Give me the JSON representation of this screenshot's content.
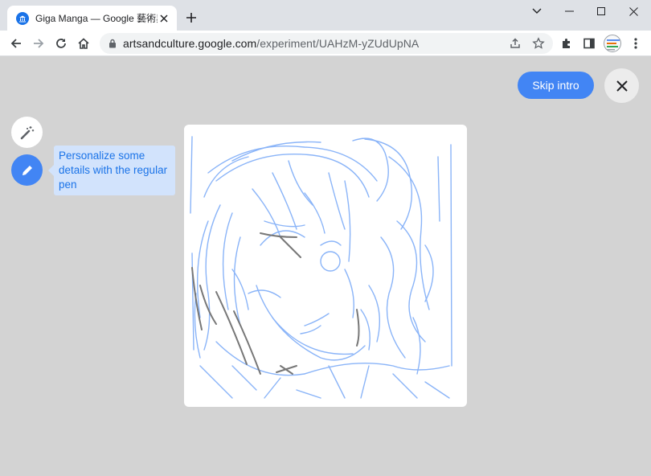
{
  "browser": {
    "tab_title": "Giga Manga — Google 藝術與文化",
    "url_host": "artsandculture.google.com",
    "url_path": "/experiment/UAHzM-yZUdUpNA",
    "icons": [
      "tab-favicon",
      "tab-close-icon",
      "new-tab-icon",
      "tab-search-icon",
      "minimize-icon",
      "maximize-icon",
      "window-close-icon",
      "back-icon",
      "forward-icon",
      "reload-icon",
      "home-icon",
      "lock-icon",
      "share-icon",
      "bookmark-star-icon",
      "extensions-icon",
      "side-panel-icon",
      "profile-avatar",
      "menu-icon"
    ]
  },
  "page": {
    "skip_intro_label": "Skip intro",
    "tooltip_text": "Personalize some details with the regular pen",
    "tools": [
      "magic-wand-icon",
      "pen-icon"
    ],
    "colors": {
      "accent": "#4285f4",
      "page_bg": "#d3d3d3",
      "tooltip_bg": "#d2e3fc",
      "tooltip_text": "#1a73e8",
      "sketch_blue": "#8ab4f8",
      "sketch_gray": "#777777"
    }
  }
}
